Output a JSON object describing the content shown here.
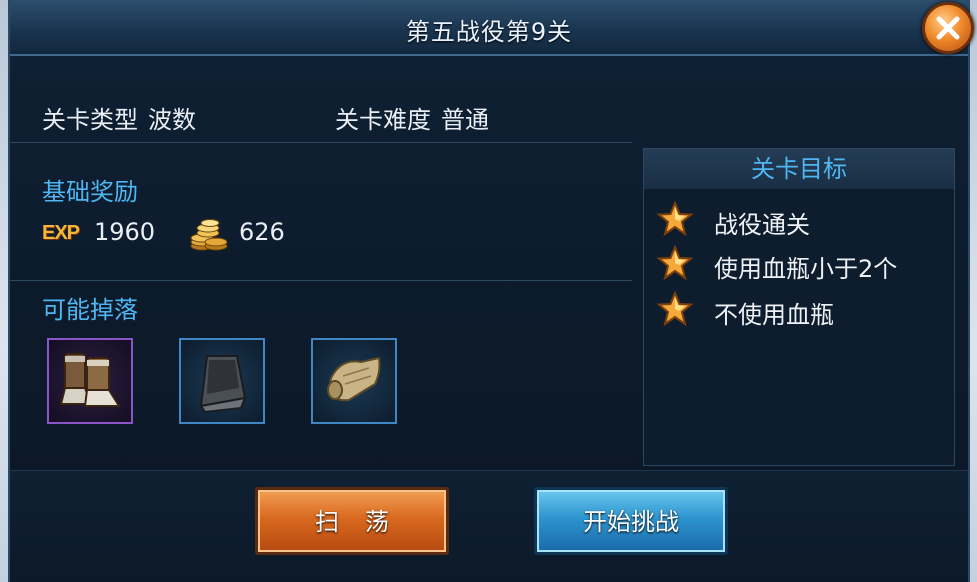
{
  "window": {
    "title": "第五战役第9关",
    "close_icon": "close-x-icon"
  },
  "stage_info": {
    "type_label": "关卡类型",
    "type_value": "波数",
    "difficulty_label": "关卡难度",
    "difficulty_value": "普通"
  },
  "rewards": {
    "title": "基础奖励",
    "exp_badge": "EXP",
    "exp_value": "1960",
    "coin_icon": "gold-coins-icon",
    "coin_value": "626"
  },
  "drops": {
    "title": "可能掉落",
    "items": [
      {
        "icon": "boots-icon",
        "rarity_color": "#8a55c8"
      },
      {
        "icon": "iron-ingot-icon",
        "rarity_color": "#3e86c6"
      },
      {
        "icon": "scroll-icon",
        "rarity_color": "#3e86c6"
      }
    ]
  },
  "goals": {
    "title": "关卡目标",
    "items": [
      {
        "icon": "star-icon",
        "label": "战役通关"
      },
      {
        "icon": "star-icon",
        "label": "使用血瓶小于2个"
      },
      {
        "icon": "star-icon",
        "label": "不使用血瓶"
      }
    ]
  },
  "buttons": {
    "sweep_label": "扫荡",
    "start_label": "开始挑战"
  },
  "colors": {
    "accent_blue": "#4fb6f2",
    "exp_gold": "#f6b43a",
    "sweep_orange": "#d9691f",
    "start_blue": "#2d94cf"
  }
}
